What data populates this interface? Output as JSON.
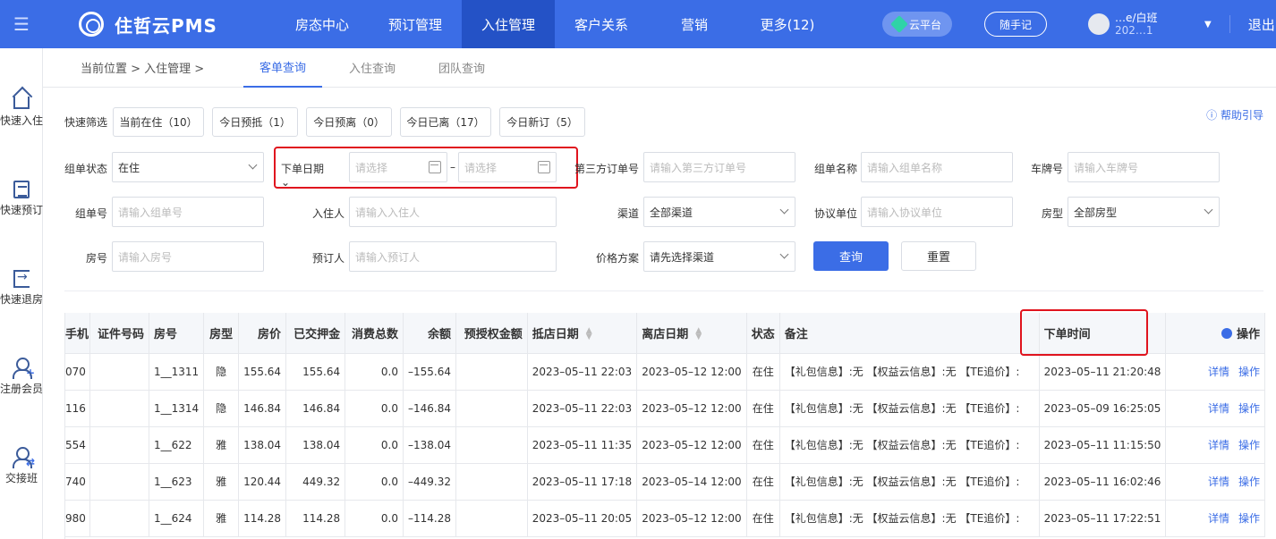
{
  "topbar": {
    "logo": "住哲云PMS",
    "nav": [
      "房态中心",
      "预订管理",
      "入住管理",
      "客户关系",
      "营销",
      "更多(12)"
    ],
    "active_nav": "入住管理",
    "cloud": "云平台",
    "note": "随手记",
    "user_line1": "…e/白班",
    "user_line2": "202…1",
    "logout": "退出"
  },
  "sidebar": [
    {
      "label": "快速入住",
      "icon": "house-icon"
    },
    {
      "label": "快速预订",
      "icon": "list-icon"
    },
    {
      "label": "快速退房",
      "icon": "checkout-icon"
    },
    {
      "label": "注册会员",
      "icon": "user-add-icon"
    },
    {
      "label": "交接班",
      "icon": "user-switch-icon"
    }
  ],
  "crumb": "当前位置 > 入住管理 >",
  "tabs": [
    "客单查询",
    "入住查询",
    "团队查询"
  ],
  "help": "帮助引导",
  "quick": {
    "label": "快速筛选",
    "chips": [
      "当前在住（10）",
      "今日预抵（1）",
      "今日预离（0）",
      "今日已离（17）",
      "今日新订（5）"
    ]
  },
  "filters": {
    "group_status_label": "组单状态",
    "group_status_value": "在住",
    "order_date_label": "下单日期",
    "date_placeholder": "请选择",
    "date_sep": "–",
    "third_order_label": "第三方订单号",
    "third_order_ph": "请输入第三方订单号",
    "group_name_label": "组单名称",
    "group_name_ph": "请输入组单名称",
    "plate_label": "车牌号",
    "plate_ph": "请输入车牌号",
    "group_no_label": "组单号",
    "group_no_ph": "请输入组单号",
    "guest_label": "入住人",
    "guest_ph": "请输入入住人",
    "channel_label": "渠道",
    "channel_value": "全部渠道",
    "agreement_label": "协议单位",
    "agreement_ph": "请输入协议单位",
    "roomtype_label": "房型",
    "roomtype_value": "全部房型",
    "room_label": "房号",
    "room_ph": "请输入房号",
    "booker_label": "预订人",
    "booker_ph": "请输入预订人",
    "price_label": "价格方案",
    "price_value": "请先选择渠道",
    "search": "查询",
    "reset": "重置"
  },
  "table": {
    "headers": [
      "手机",
      "证件号码",
      "房号",
      "房型",
      "房价",
      "已交押金",
      "消费总数",
      "余额",
      "预授权金额",
      "抵店日期",
      "离店日期",
      "状态",
      "备注",
      "下单时间",
      "操作"
    ],
    "detail": "详情",
    "action": "操作",
    "rows": [
      {
        "phone": "070",
        "id": "",
        "room": "1__1311",
        "type": "隐",
        "price": "155.64",
        "deposit": "155.64",
        "consume": "0.0",
        "balance": "–155.64",
        "preauth": "",
        "arrive": "2023–05–11 22:03",
        "leave": "2023–05–12 12:00",
        "status": "在住",
        "remark": "【礼包信息】:无 【权益云信息】:无 【TE追价】:",
        "ordertime": "2023–05–11 21:20:48"
      },
      {
        "phone": "116",
        "id": "",
        "room": "1__1314",
        "type": "隐",
        "price": "146.84",
        "deposit": "146.84",
        "consume": "0.0",
        "balance": "–146.84",
        "preauth": "",
        "arrive": "2023–05–11 22:03",
        "leave": "2023–05–12 12:00",
        "status": "在住",
        "remark": "【礼包信息】:无 【权益云信息】:无 【TE追价】:",
        "ordertime": "2023–05–09 16:25:05"
      },
      {
        "phone": "554",
        "id": "",
        "room": "1__622",
        "type": "雅",
        "price": "138.04",
        "deposit": "138.04",
        "consume": "0.0",
        "balance": "–138.04",
        "preauth": "",
        "arrive": "2023–05–11 11:35",
        "leave": "2023–05–12 12:00",
        "status": "在住",
        "remark": "【礼包信息】:无 【权益云信息】:无 【TE追价】:",
        "ordertime": "2023–05–11 11:15:50"
      },
      {
        "phone": "740",
        "id": "",
        "room": "1__623",
        "type": "雅",
        "price": "120.44",
        "deposit": "449.32",
        "consume": "0.0",
        "balance": "–449.32",
        "preauth": "",
        "arrive": "2023–05–11 17:18",
        "leave": "2023–05–14 12:00",
        "status": "在住",
        "remark": "【礼包信息】:无 【权益云信息】:无 【TE追价】:",
        "ordertime": "2023–05–11 16:02:46"
      },
      {
        "phone": "980",
        "id": "",
        "room": "1__624",
        "type": "雅",
        "price": "114.28",
        "deposit": "114.28",
        "consume": "0.0",
        "balance": "–114.28",
        "preauth": "",
        "arrive": "2023–05–11 20:05",
        "leave": "2023–05–12 12:00",
        "status": "在住",
        "remark": "【礼包信息】:无 【权益云信息】:无 【TE追价】:",
        "ordertime": "2023–05–11 17:22:51"
      }
    ]
  },
  "colors": {
    "primary": "#3b6de6",
    "highlight": "#e0141e"
  }
}
